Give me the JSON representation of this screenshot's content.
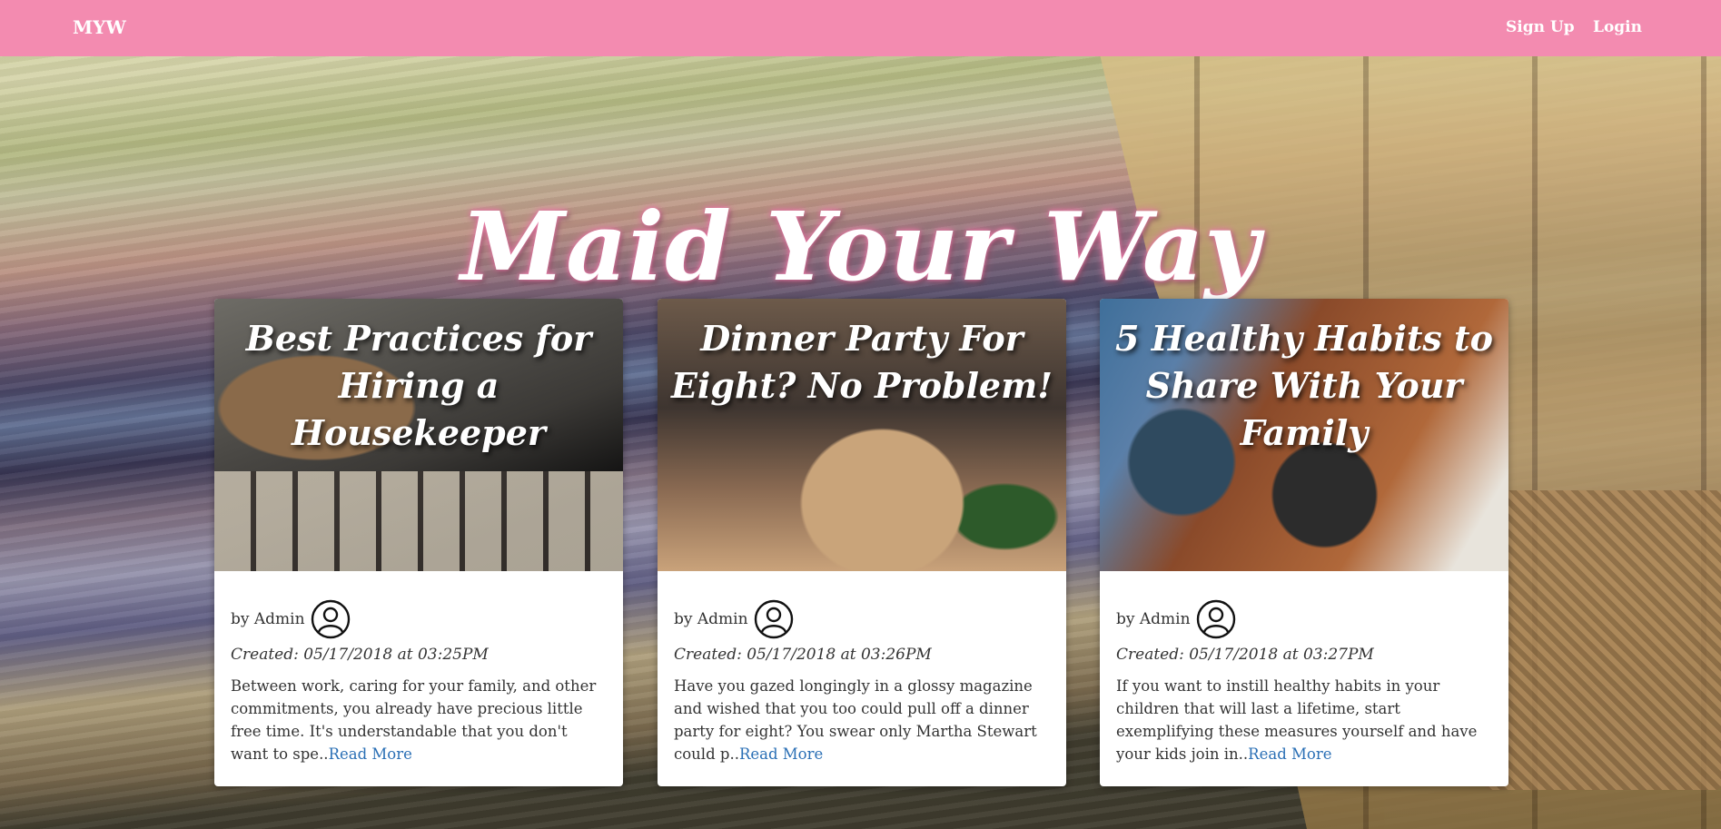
{
  "navbar": {
    "brand": "MYW",
    "signup": "Sign Up",
    "login": "Login"
  },
  "hero": {
    "title": "Maid Your Way"
  },
  "posts": [
    {
      "title": "Best Practices for Hiring a Housekeeper",
      "author": "by Admin",
      "created": "Created: 05/17/2018 at 03:25PM",
      "excerpt": "Between work, caring for your family, and other commitments, you already have precious little free time. It's understandable that you don't want to spe..",
      "read_more": "Read More"
    },
    {
      "title": "Dinner Party For Eight? No Problem!",
      "author": "by Admin",
      "created": "Created: 05/17/2018 at 03:26PM",
      "excerpt": "Have you gazed longingly in a glossy magazine and wished that you too could pull off a dinner party for eight? You swear only Martha Stewart could p..",
      "read_more": "Read More"
    },
    {
      "title": "5 Healthy Habits to Share With Your Family",
      "author": "by Admin",
      "created": "Created: 05/17/2018 at 03:27PM",
      "excerpt": "If you want to instill healthy habits in your children that will last a lifetime, start exemplifying these measures yourself and have your kids join in..",
      "read_more": "Read More"
    }
  ],
  "colors": {
    "navbar": "#f38bb0",
    "link": "#2a6fb5",
    "title_glow": "#e97aa6"
  },
  "icons": {
    "avatar": "user-circle-icon"
  }
}
